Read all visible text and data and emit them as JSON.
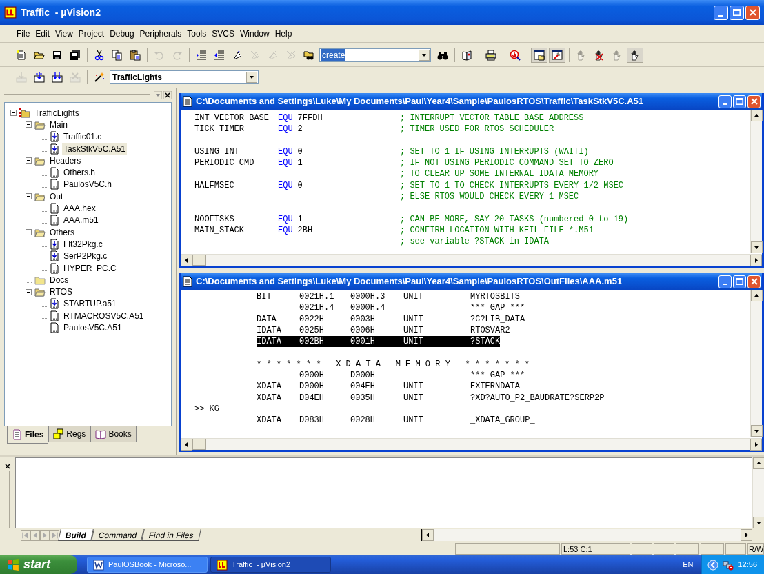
{
  "window": {
    "title": "Traffic  - µVision2"
  },
  "menu": [
    "File",
    "Edit",
    "View",
    "Project",
    "Debug",
    "Peripherals",
    "Tools",
    "SVCS",
    "Window",
    "Help"
  ],
  "toolbar_1": [
    {
      "kind": "new",
      "disabled": false,
      "pressed": false
    },
    {
      "kind": "open",
      "disabled": false,
      "pressed": false
    },
    {
      "kind": "save",
      "disabled": false,
      "pressed": false
    },
    {
      "kind": "saveall",
      "disabled": false,
      "pressed": false
    },
    {
      "kind": "separator"
    },
    {
      "kind": "cut",
      "disabled": false,
      "pressed": false
    },
    {
      "kind": "copy",
      "disabled": false,
      "pressed": false
    },
    {
      "kind": "paste",
      "disabled": false,
      "pressed": false
    },
    {
      "kind": "separator"
    },
    {
      "kind": "undo",
      "disabled": true,
      "pressed": false
    },
    {
      "kind": "redo",
      "disabled": true,
      "pressed": false
    },
    {
      "kind": "separator"
    },
    {
      "kind": "indent",
      "disabled": false,
      "pressed": false
    },
    {
      "kind": "outdent",
      "disabled": false,
      "pressed": false
    },
    {
      "kind": "bookmark",
      "disabled": false,
      "pressed": false
    },
    {
      "kind": "nextmark",
      "disabled": true,
      "pressed": false
    },
    {
      "kind": "prevmark",
      "disabled": true,
      "pressed": false
    },
    {
      "kind": "clearmark",
      "disabled": true,
      "pressed": false
    },
    {
      "kind": "findfiles",
      "disabled": false,
      "pressed": false
    },
    {
      "kind": "combo",
      "value": "create",
      "highlighted": true
    },
    {
      "kind": "find",
      "disabled": false,
      "pressed": false
    },
    {
      "kind": "separator"
    },
    {
      "kind": "book",
      "disabled": false,
      "pressed": false
    },
    {
      "kind": "separator"
    },
    {
      "kind": "print",
      "disabled": false,
      "pressed": false
    },
    {
      "kind": "separator"
    },
    {
      "kind": "debug",
      "disabled": false,
      "pressed": false
    },
    {
      "kind": "separator"
    },
    {
      "kind": "workspace",
      "disabled": false,
      "pressed": true
    },
    {
      "kind": "outputwin",
      "disabled": false,
      "pressed": true
    },
    {
      "kind": "separator"
    },
    {
      "kind": "hand",
      "disabled": true,
      "pressed": false
    },
    {
      "kind": "handx",
      "disabled": false,
      "pressed": false
    },
    {
      "kind": "hand",
      "disabled": true,
      "pressed": false
    },
    {
      "kind": "hand",
      "disabled": false,
      "pressed": true
    }
  ],
  "toolbar_2": [
    {
      "kind": "load",
      "disabled": true,
      "pressed": false
    },
    {
      "kind": "build",
      "disabled": false,
      "pressed": false
    },
    {
      "kind": "rebuild",
      "disabled": false,
      "pressed": false
    },
    {
      "kind": "stop",
      "disabled": true,
      "pressed": false
    },
    {
      "kind": "separator"
    },
    {
      "kind": "wand",
      "disabled": false,
      "pressed": false
    },
    {
      "kind": "combo",
      "value": "TrafficLights",
      "highlighted": false
    }
  ],
  "project_tree": [
    {
      "label": "TrafficLights",
      "kind": "project",
      "expanded": true,
      "selected": false,
      "children": [
        {
          "label": "Main",
          "kind": "folder",
          "expanded": true,
          "selected": false,
          "children": [
            {
              "label": "Traffic01.c",
              "kind": "source",
              "selected": false
            },
            {
              "label": "TaskStkV5C.A51",
              "kind": "source",
              "selected": true
            }
          ]
        },
        {
          "label": "Headers",
          "kind": "folder",
          "expanded": true,
          "selected": false,
          "children": [
            {
              "label": "Others.h",
              "kind": "document",
              "selected": false
            },
            {
              "label": "PaulosV5C.h",
              "kind": "document",
              "selected": false
            }
          ]
        },
        {
          "label": "Out",
          "kind": "folder",
          "expanded": true,
          "selected": false,
          "children": [
            {
              "label": "AAA.hex",
              "kind": "document",
              "selected": false
            },
            {
              "label": "AAA.m51",
              "kind": "document",
              "selected": false
            }
          ]
        },
        {
          "label": "Others",
          "kind": "folder",
          "expanded": true,
          "selected": false,
          "children": [
            {
              "label": "Flt32Pkg.c",
              "kind": "source",
              "selected": false
            },
            {
              "label": "SerP2Pkg.c",
              "kind": "source",
              "selected": false
            },
            {
              "label": "HYPER_PC.C",
              "kind": "document",
              "selected": false
            }
          ]
        },
        {
          "label": "Docs",
          "kind": "folder",
          "expanded": false,
          "selected": false
        },
        {
          "label": "RTOS",
          "kind": "folder",
          "expanded": true,
          "selected": false,
          "children": [
            {
              "label": "STARTUP.a51",
              "kind": "source",
              "selected": false
            },
            {
              "label": "RTMACROSV5C.A51",
              "kind": "document",
              "selected": false
            },
            {
              "label": "PaulosV5C.A51",
              "kind": "document",
              "selected": false
            }
          ]
        }
      ]
    }
  ],
  "panel_tabs": [
    {
      "label": "Files",
      "kind": "files",
      "selected": true
    },
    {
      "label": "Regs",
      "kind": "regs",
      "selected": false
    },
    {
      "label": "Books",
      "kind": "books",
      "selected": false
    }
  ],
  "editor_1": {
    "title": "C:\\Documents and Settings\\Luke\\My Documents\\Paul\\Year4\\Sample\\PaulosRTOS\\Traffic\\TaskStkV5C.A51",
    "lines": [
      {
        "kind": "code",
        "label": "INT_VECTOR_BASE",
        "op": "EQU",
        "operand": "7FFDH",
        "comment": "; INTERRUPT VECTOR TABLE BASE ADDRESS"
      },
      {
        "kind": "code",
        "label": "TICK_TIMER",
        "op": "EQU",
        "operand": "2",
        "comment": "; TIMER USED FOR RTOS SCHEDULER"
      },
      {
        "kind": "blank"
      },
      {
        "kind": "code",
        "label": "USING_INT",
        "op": "EQU",
        "operand": "0",
        "comment": "; SET TO 1 IF USING INTERRUPTS (WAITI)"
      },
      {
        "kind": "code",
        "label": "PERIODIC_CMD",
        "op": "EQU",
        "operand": "1",
        "comment": "; IF NOT USING PERIODIC COMMAND SET TO ZERO"
      },
      {
        "kind": "code",
        "comment": "; TO CLEAR UP SOME INTERNAL IDATA MEMORY"
      },
      {
        "kind": "code",
        "label": "HALFMSEC",
        "op": "EQU",
        "operand": "0",
        "comment": "; SET TO 1 TO CHECK INTERRUPTS EVERY 1/2 MSEC"
      },
      {
        "kind": "code",
        "comment": "; ELSE RTOS WOULD CHECK EVERY 1 MSEC"
      },
      {
        "kind": "blank"
      },
      {
        "kind": "code",
        "label": "NOOFTSKS",
        "op": "EQU",
        "operand": "1",
        "comment": "; CAN BE MORE, SAY 20 TASKS (numbered 0 to 19)"
      },
      {
        "kind": "code",
        "label": "MAIN_STACK",
        "op": "EQU",
        "operand": "2BH",
        "comment": "; CONFIRM LOCATION WITH KEIL FILE *.M51"
      },
      {
        "kind": "code",
        "comment": "; see variable ?STACK in IDATA"
      }
    ]
  },
  "editor_2": {
    "title": "C:\\Documents and Settings\\Luke\\My Documents\\Paul\\Year4\\Sample\\PaulosRTOS\\OutFiles\\AAA.m51",
    "lines": [
      {
        "kind": "map",
        "type": "BIT",
        "start": "0021H.1",
        "length": "0000H.3",
        "reloc": "UNIT",
        "name": "MYRTOSBITS",
        "selected": false
      },
      {
        "kind": "map",
        "start": "0021H.4",
        "length": "0000H.4",
        "name": "*** GAP ***",
        "selected": false
      },
      {
        "kind": "map",
        "type": "DATA",
        "start": "0022H",
        "length": "0003H",
        "reloc": "UNIT",
        "name": "?C?LIB_DATA",
        "selected": false
      },
      {
        "kind": "map",
        "type": "IDATA",
        "start": "0025H",
        "length": "0006H",
        "reloc": "UNIT",
        "name": "RTOSVAR2",
        "selected": false
      },
      {
        "kind": "map",
        "type": "IDATA",
        "start": "002BH",
        "length": "0001H",
        "reloc": "UNIT",
        "name": "?STACK",
        "selected": true
      },
      {
        "kind": "blank"
      },
      {
        "kind": "heading",
        "text": "* * * * * * *   X D A T A   M E M O R Y   * * * * * * *"
      },
      {
        "kind": "map",
        "start": "0000H",
        "length": "D000H",
        "name": "*** GAP ***",
        "selected": false
      },
      {
        "kind": "map",
        "type": "XDATA",
        "start": "D000H",
        "length": "004EH",
        "reloc": "UNIT",
        "name": "EXTERNDATA",
        "selected": false
      },
      {
        "kind": "map",
        "type": "XDATA",
        "start": "D04EH",
        "length": "0035H",
        "reloc": "UNIT",
        "name": "?XD?AUTO_P2_BAUDRATE?SERP2P",
        "selected": false
      },
      {
        "kind": "text",
        "text": ">> KG"
      },
      {
        "kind": "map",
        "type": "XDATA",
        "start": "D083H",
        "length": "0028H",
        "reloc": "UNIT",
        "name": "_XDATA_GROUP_",
        "selected": false
      }
    ]
  },
  "output_tabs": [
    {
      "label": "Build",
      "selected": true
    },
    {
      "label": "Command",
      "selected": false
    },
    {
      "label": "Find in Files",
      "selected": false
    }
  ],
  "status_bar": {
    "position": "L:53 C:1",
    "mode": "R/W"
  },
  "taskbar": {
    "start": "start",
    "tasks": [
      {
        "label": "PaulOSBook - Microso...",
        "kind": "word",
        "selected": false
      },
      {
        "label": "Traffic  - µVision2",
        "kind": "uvision",
        "selected": true
      }
    ],
    "language": "EN",
    "clock": "12:56"
  }
}
